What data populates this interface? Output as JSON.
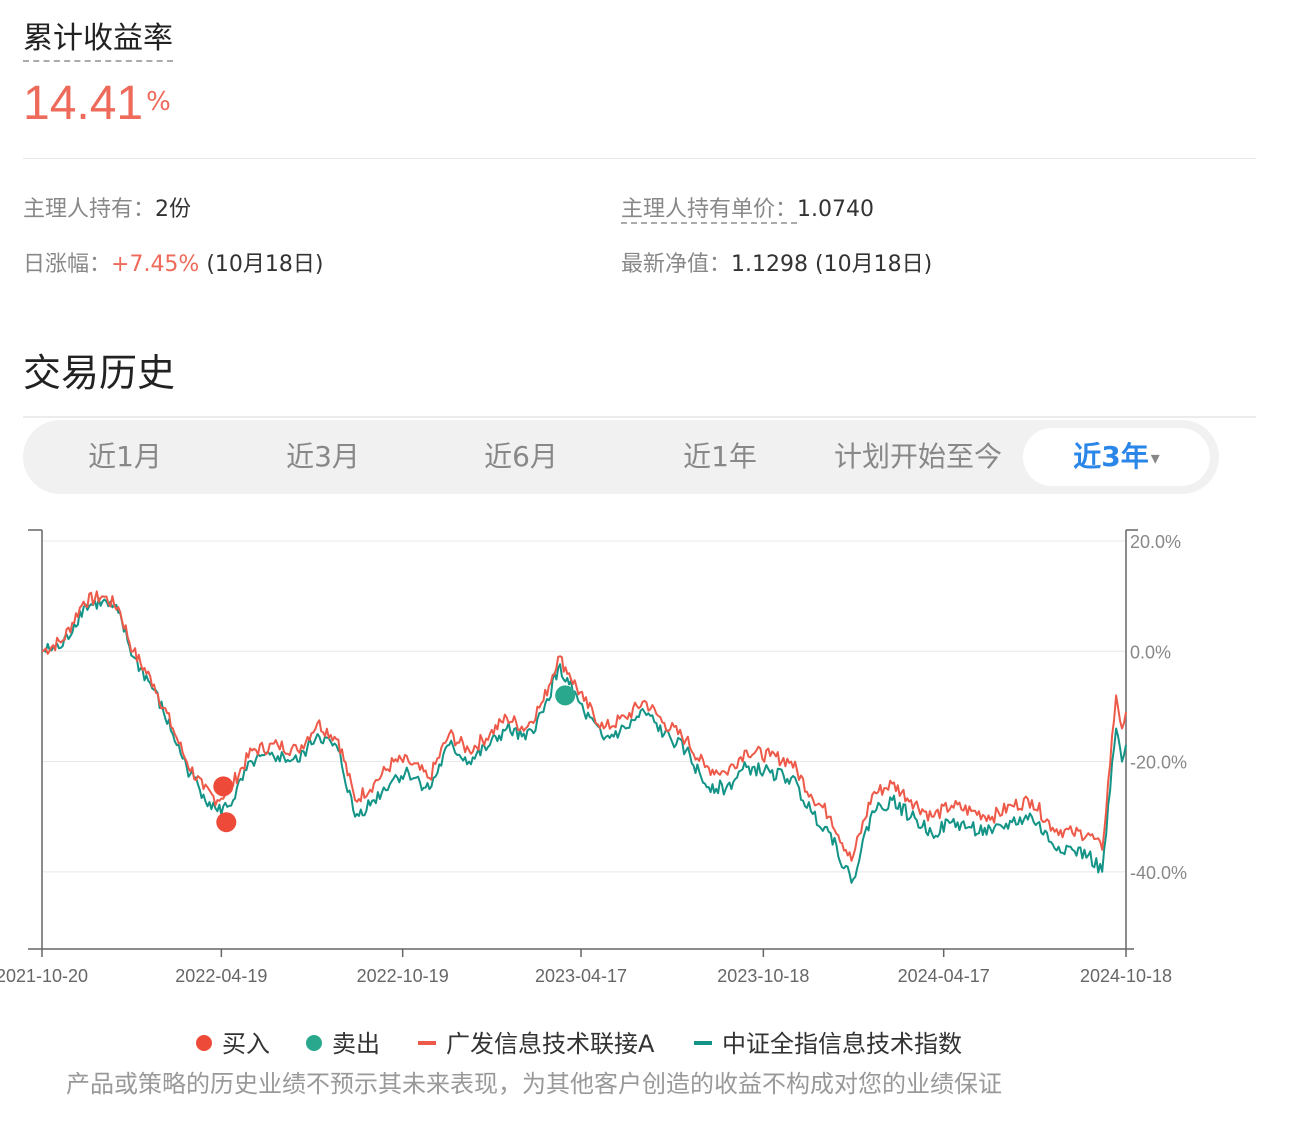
{
  "header": {
    "title": "累计收益率",
    "value": "14.41",
    "unit": "%"
  },
  "info": {
    "holding_label": "主理人持有：",
    "holding_value": "2份",
    "unit_price_label": "主理人持有单价：",
    "unit_price_value": "1.0740",
    "daily_label": "日涨幅：",
    "daily_value": "+7.45%",
    "daily_date": "(10月18日)",
    "nav_label": "最新净值：",
    "nav_value": "1.1298",
    "nav_date": "(10月18日)"
  },
  "history": {
    "title": "交易历史",
    "tabs": [
      {
        "label": "近1月"
      },
      {
        "label": "近3月"
      },
      {
        "label": "近6月"
      },
      {
        "label": "近1年"
      },
      {
        "label": "计划开始至今"
      },
      {
        "label": "近3年",
        "caret": "▾"
      }
    ],
    "active_tab": 5
  },
  "legend": {
    "buy": "买入",
    "sell": "卖出",
    "fund": "广发信息技术联接A",
    "index": "中证全指信息技术指数"
  },
  "disclaimer": "产品或策略的历史业绩不预示其未来表现，为其他客户创造的收益不构成对您的业绩保证",
  "colors": {
    "fund": "#ee5a4a",
    "index": "#139487",
    "buy": "#ee4a3a",
    "sell": "#2aa88e",
    "accent": "#2a86e8"
  },
  "chart_data": {
    "type": "line",
    "x_range": [
      "2021-10-20",
      "2024-10-18"
    ],
    "x_ticks": [
      "2021-10-20",
      "2022-04-19",
      "2022-10-19",
      "2023-04-17",
      "2023-10-18",
      "2024-04-17",
      "2024-10-18"
    ],
    "ylim": [
      -54,
      22
    ],
    "y_ticks": [
      20,
      0,
      -20,
      -40
    ],
    "y_tick_labels": [
      "20.0%",
      "0.0%",
      "-20.0%",
      "-40.0%"
    ],
    "y_axis_side": "right",
    "grid": true,
    "legend_position": "bottom",
    "series": [
      {
        "name": "广发信息技术联接A",
        "x": [
          "2021-10-20",
          "2021-11-10",
          "2021-12-01",
          "2021-12-20",
          "2022-01-05",
          "2022-01-20",
          "2022-02-10",
          "2022-03-01",
          "2022-03-15",
          "2022-04-01",
          "2022-04-15",
          "2022-04-27",
          "2022-05-20",
          "2022-06-15",
          "2022-07-05",
          "2022-07-25",
          "2022-08-15",
          "2022-09-01",
          "2022-09-20",
          "2022-10-10",
          "2022-10-25",
          "2022-11-15",
          "2022-12-05",
          "2022-12-25",
          "2023-01-15",
          "2023-02-01",
          "2023-02-20",
          "2023-03-10",
          "2023-03-25",
          "2023-04-05",
          "2023-04-20",
          "2023-05-10",
          "2023-06-01",
          "2023-06-20",
          "2023-07-10",
          "2023-08-01",
          "2023-08-20",
          "2023-09-10",
          "2023-10-01",
          "2023-10-25",
          "2023-11-15",
          "2023-12-05",
          "2023-12-25",
          "2024-01-15",
          "2024-02-05",
          "2024-02-25",
          "2024-03-15",
          "2024-04-05",
          "2024-04-25",
          "2024-05-15",
          "2024-06-05",
          "2024-06-25",
          "2024-07-15",
          "2024-08-05",
          "2024-08-25",
          "2024-09-10",
          "2024-09-24",
          "2024-10-08",
          "2024-10-14",
          "2024-10-18"
        ],
        "values": [
          0,
          2,
          9,
          10,
          8,
          0,
          -6,
          -14,
          -20,
          -25,
          -27,
          -25,
          -18,
          -17,
          -18,
          -13,
          -16,
          -27,
          -24,
          -20,
          -20,
          -23,
          -15,
          -18,
          -15,
          -12,
          -14,
          -9,
          -1,
          -4,
          -9,
          -14,
          -12,
          -9,
          -13,
          -16,
          -21,
          -22,
          -18,
          -19,
          -20,
          -26,
          -30,
          -38,
          -26,
          -24,
          -27,
          -30,
          -28,
          -29,
          -30,
          -28,
          -27,
          -32,
          -33,
          -33,
          -36,
          -8,
          -14,
          -11
        ]
      },
      {
        "name": "中证全指信息技术指数",
        "x": [
          "2021-10-20",
          "2021-11-10",
          "2021-12-01",
          "2021-12-20",
          "2022-01-05",
          "2022-01-20",
          "2022-02-10",
          "2022-03-01",
          "2022-03-15",
          "2022-04-01",
          "2022-04-15",
          "2022-04-27",
          "2022-05-20",
          "2022-06-15",
          "2022-07-05",
          "2022-07-25",
          "2022-08-15",
          "2022-09-01",
          "2022-09-20",
          "2022-10-10",
          "2022-10-25",
          "2022-11-15",
          "2022-12-05",
          "2022-12-25",
          "2023-01-15",
          "2023-02-01",
          "2023-02-20",
          "2023-03-10",
          "2023-03-25",
          "2023-04-05",
          "2023-04-20",
          "2023-05-10",
          "2023-06-01",
          "2023-06-20",
          "2023-07-10",
          "2023-08-01",
          "2023-08-20",
          "2023-09-10",
          "2023-10-01",
          "2023-10-25",
          "2023-11-15",
          "2023-12-05",
          "2023-12-25",
          "2024-01-15",
          "2024-02-05",
          "2024-02-25",
          "2024-03-15",
          "2024-04-05",
          "2024-04-25",
          "2024-05-15",
          "2024-06-05",
          "2024-06-25",
          "2024-07-15",
          "2024-08-05",
          "2024-08-25",
          "2024-09-10",
          "2024-09-24",
          "2024-10-08",
          "2024-10-14",
          "2024-10-18"
        ],
        "values": [
          0,
          1,
          8,
          9,
          7,
          -1,
          -7,
          -15,
          -21,
          -26,
          -29,
          -28,
          -20,
          -19,
          -20,
          -15,
          -18,
          -30,
          -27,
          -23,
          -22,
          -25,
          -17,
          -20,
          -17,
          -14,
          -16,
          -11,
          -3,
          -6,
          -11,
          -16,
          -14,
          -11,
          -15,
          -18,
          -24,
          -25,
          -21,
          -22,
          -23,
          -29,
          -33,
          -42,
          -29,
          -27,
          -30,
          -33,
          -31,
          -32,
          -33,
          -31,
          -30,
          -35,
          -36,
          -37,
          -40,
          -14,
          -20,
          -17
        ]
      }
    ],
    "markers": [
      {
        "type": "buy",
        "x": "2022-04-21",
        "y": -24.5
      },
      {
        "type": "buy",
        "x": "2022-04-24",
        "y": -31
      },
      {
        "type": "sell",
        "x": "2023-04-01",
        "y": -8
      }
    ]
  }
}
